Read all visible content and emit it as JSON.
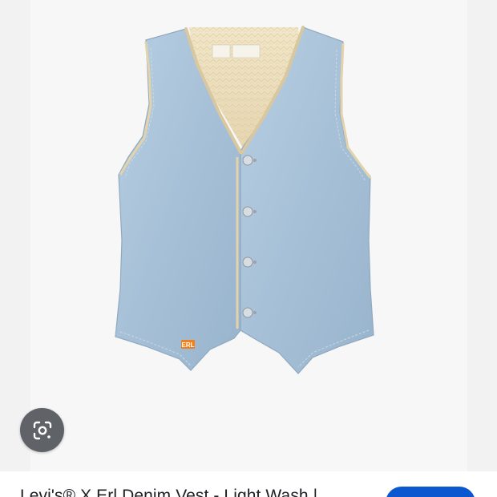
{
  "product": {
    "title": "Levi's® X Erl Denim Vest - Light Wash |",
    "brand_tag": "ERL"
  },
  "icons": {
    "lens": "google-lens-icon"
  },
  "colors": {
    "page_background": "#f2f2f2",
    "photo_background": "#f7f7f7",
    "denim": "#a9c3d9",
    "sherpa_lining": "#efe3c3",
    "lens_button": "#5f6368",
    "visit_button": "#0b57d0",
    "brand_tag": "#f07f1c"
  }
}
